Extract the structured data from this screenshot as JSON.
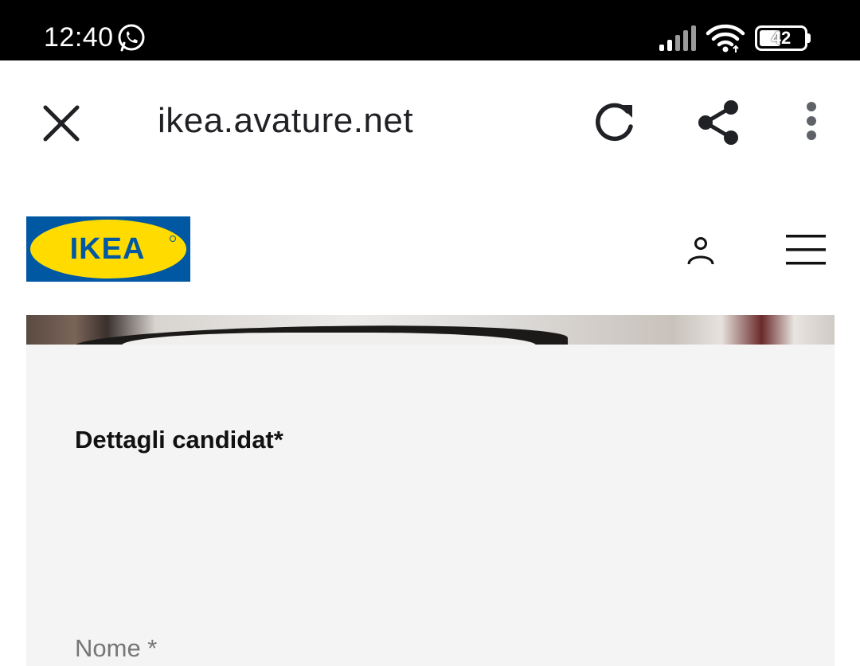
{
  "status_bar": {
    "time": "12:40",
    "battery_level": "42",
    "icons": [
      "whatsapp-icon",
      "signal-icon",
      "wifi-icon",
      "battery-icon"
    ]
  },
  "browser": {
    "url": "ikea.avature.net",
    "icons": [
      "close-icon",
      "reload-icon",
      "share-icon",
      "more-vert-icon"
    ]
  },
  "site": {
    "logo_text": "IKEA",
    "colors": {
      "logo_blue": "#0058a3",
      "logo_yellow": "#ffdb00"
    },
    "icons": [
      "user-icon",
      "hamburger-menu-icon"
    ]
  },
  "form": {
    "section_title": "Dettagli candidat*",
    "first_field_label": "Nome *"
  }
}
